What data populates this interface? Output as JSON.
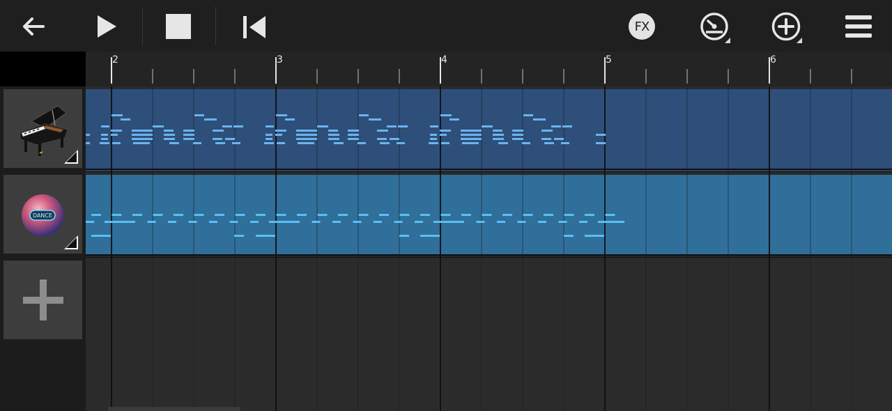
{
  "toolbar": {
    "fx_label": "FX",
    "icons": [
      "arrow-left-icon",
      "play-icon",
      "stop-icon",
      "skip-to-start-icon",
      "fx-icon",
      "metronome-icon",
      "add-circle-icon",
      "menu-icon"
    ]
  },
  "ruler": {
    "bar_numbers": [
      "2",
      "3",
      "4",
      "5",
      "6"
    ]
  },
  "tracks": [
    {
      "instrument": "grand-piano",
      "clip_color": "#2d4f7a",
      "note_color": "#6cb4ee"
    },
    {
      "instrument": "dance-pad",
      "clip_color": "#2f6f9a",
      "note_color": "#58c0f5",
      "logo_text": "DANCE"
    }
  ],
  "add_track": {
    "icon": "plus-icon"
  },
  "colors": {
    "toolbar_bg": "#1f1f1f",
    "grid_bg": "#2b2b2b",
    "piano_clip": "#2d4f7a",
    "dance_clip": "#2f6f9a",
    "note_blue": "#6cb4ee"
  }
}
